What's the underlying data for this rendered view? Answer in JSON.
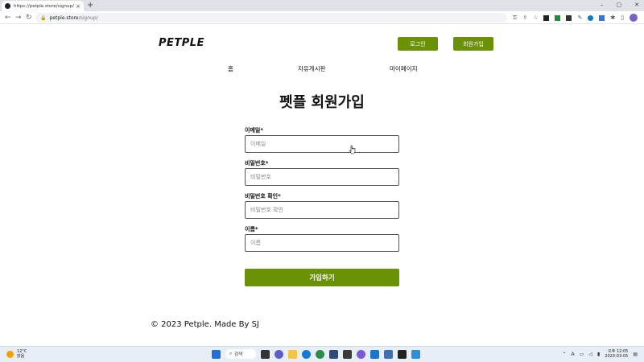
{
  "browser": {
    "tab_title": "https://petple.store/signup/",
    "tab_close": "×",
    "new_tab": "+",
    "url_host": "petple.store",
    "url_path": "/signup/",
    "win_min": "–",
    "win_max": "▢",
    "win_close": "✕"
  },
  "header": {
    "logo": "PETPLE",
    "login_label": "로그인",
    "signup_label": "회원가입"
  },
  "nav": {
    "home": "홈",
    "board": "자유게시판",
    "mypage": "마이페이지"
  },
  "form": {
    "title": "펫플 회원가입",
    "email_label": "이메일*",
    "email_placeholder": "이메일",
    "password_label": "비밀번호*",
    "password_placeholder": "비밀번호",
    "password_confirm_label": "비밀번호 확인*",
    "password_confirm_placeholder": "비밀번호 확인",
    "name_label": "이름*",
    "name_placeholder": "이름",
    "submit_label": "가입하기"
  },
  "footer": {
    "text": "© 2023 Petple. Made By SJ"
  },
  "taskbar": {
    "weather_temp": "12°C",
    "weather_desc": "맑음",
    "search_label": "검색",
    "time": "오후 12:05",
    "date": "2023-03-05"
  },
  "colors": {
    "brand_green": "#6b9107"
  }
}
